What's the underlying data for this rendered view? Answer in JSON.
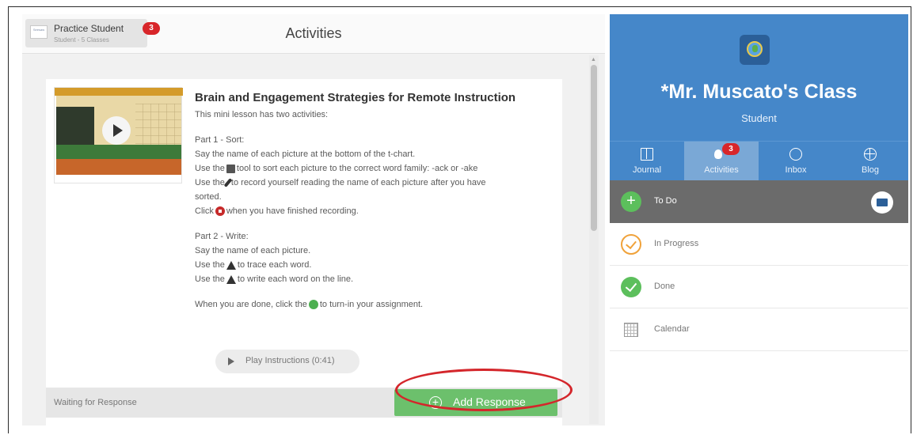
{
  "student": {
    "name": "Practice Student",
    "subtitle": "Student - 5 Classes",
    "badge": "3",
    "logo_text": "Seesaw"
  },
  "page": {
    "title": "Activities"
  },
  "activity": {
    "title": "Brain and Engagement Strategies for Remote Instruction",
    "intro": "This mini lesson has two activities:",
    "part1": {
      "heading": "Part 1 - Sort:",
      "line1": "Say the name of each picture at the bottom of the t-chart.",
      "line2_pre": "Use the",
      "line2_post": "tool to sort each picture to the correct word family: -ack or -ake",
      "line3_pre": "Use the",
      "line3_post": "to record yourself reading the name of each picture after you have",
      "line4": "sorted.",
      "line5_pre": "Click",
      "line5_post": "when you have finished recording."
    },
    "part2": {
      "heading": "Part 2 - Write:",
      "line1": "Say the name of each picture.",
      "line2_pre": "Use the",
      "line2_post": "to trace each word.",
      "line3_pre": "Use the",
      "line3_post": "to write each word on the line."
    },
    "turnin_pre": "When you are done, click the",
    "turnin_post": "to turn-in your assignment.",
    "play_instructions": "Play Instructions (0:41)",
    "waiting": "Waiting for Response",
    "add_response": "Add Response",
    "add_response_icon": "+"
  },
  "class": {
    "name": "*Mr. Muscato's Class",
    "role": "Student"
  },
  "nav": {
    "journal": "Journal",
    "activities": "Activities",
    "activities_badge": "3",
    "inbox": "Inbox",
    "blog": "Blog"
  },
  "lists": {
    "todo": "To Do",
    "todo_icon": "+",
    "in_progress": "In Progress",
    "done": "Done",
    "calendar": "Calendar"
  },
  "colors": {
    "class_blue": "#4587c9",
    "active_tab": "#7aa8d6",
    "todo_bar": "#6b6b6b",
    "green": "#6cc06c",
    "badge_red": "#d8262a",
    "highlight_ring": "#d4262b"
  },
  "icons": {
    "thumbnail_play": "play-icon",
    "sort_tool": "sort-tool-icon",
    "mic": "mic-icon",
    "stop": "stop-record-icon",
    "trace_tool": "triangle-tool-icon",
    "check": "check-icon",
    "globe": "globe-icon",
    "folder": "folder-icon",
    "calendar": "calendar-icon"
  }
}
